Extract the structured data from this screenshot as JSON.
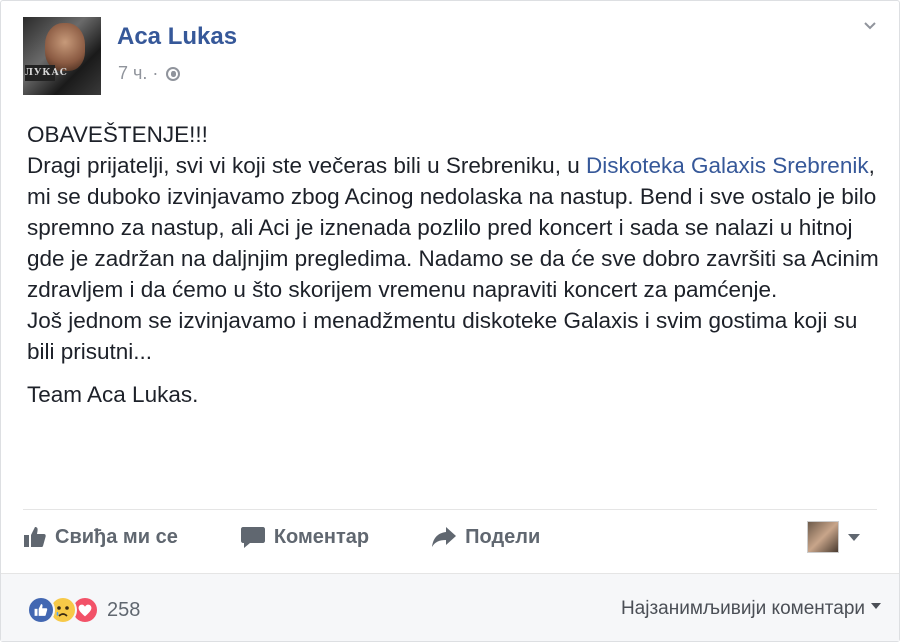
{
  "post": {
    "author": "Aca Lukas",
    "time": "7 ч.",
    "time_separator": "·",
    "audience_icon": "globe-icon",
    "avatar_text": "ЛУКАС",
    "headline": "OBAVEŠTENJE!!!",
    "body_part1": "Dragi prijatelji, svi vi koji ste večeras bili u Srebreniku, u ",
    "body_link": "Diskoteka Galaxis Srebrenik",
    "body_part2": ", mi se duboko izvinjavamo zbog Acinog nedolaska na nastup. Bend i sve ostalo je bilo spremno za nastup, ali Aci je iznenada pozlilo pred koncert i sada se nalazi u hitnoj gde je zadržan na daljnjim pregledima. Nadamo se da će sve dobro završiti sa Acinim zdravljem i da ćemo u što skorijem vremenu napraviti koncert za pamćenje.",
    "body_part3": "Još jednom se izvinjavamo i menadžmentu diskoteke Galaxis i svim gostima koji su bili prisutni...",
    "signature": "Team Aca Lukas."
  },
  "actions": {
    "like_label": "Свиђа ми се",
    "comment_label": "Коментар",
    "share_label": "Подели"
  },
  "footer": {
    "reaction_count": "258",
    "sort_label": "Најзанимљивији коментари"
  },
  "colors": {
    "link": "#365899",
    "like_reaction": "#4267b2",
    "love_reaction": "#f25268",
    "sad_reaction": "#f7c948"
  }
}
